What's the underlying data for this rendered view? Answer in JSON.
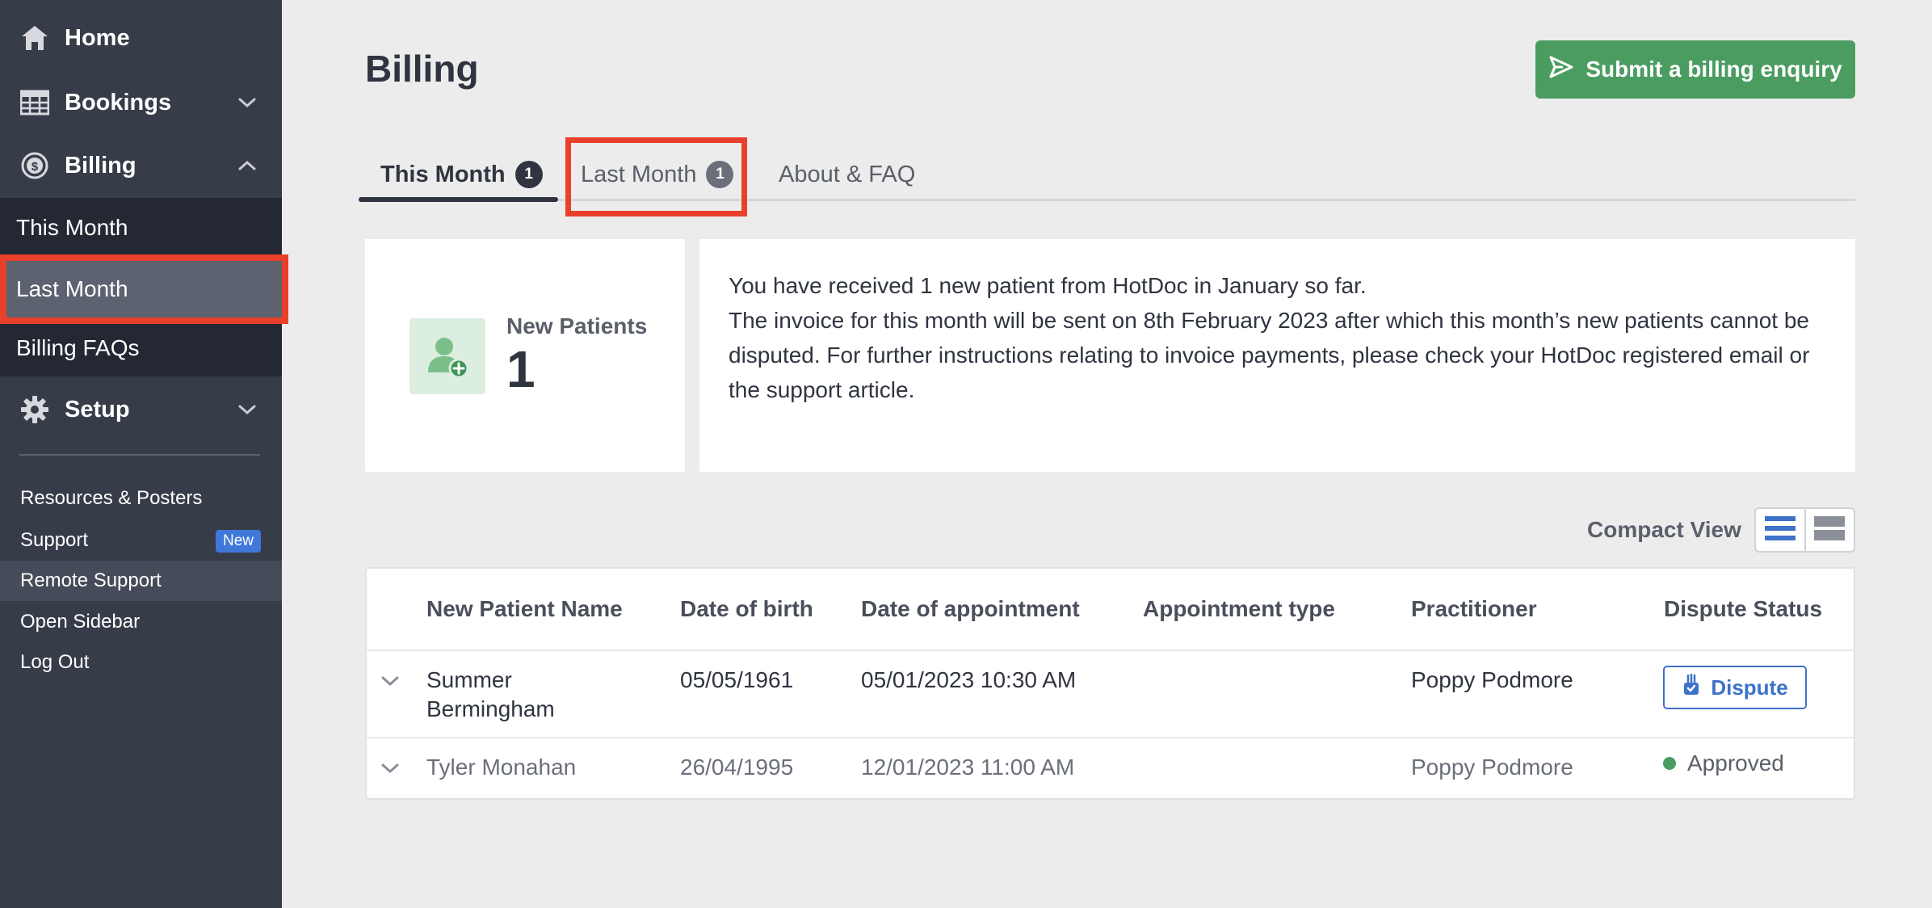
{
  "sidebar": {
    "home": "Home",
    "bookings": "Bookings",
    "billing": "Billing",
    "billing_sub": [
      "This Month",
      "Last Month",
      "Billing FAQs"
    ],
    "setup": "Setup",
    "links": [
      "Resources & Posters",
      "Support",
      "Remote Support",
      "Open Sidebar",
      "Log Out"
    ],
    "support_badge": "New"
  },
  "header": {
    "title": "Billing",
    "enquiry_button": "Submit a billing enquiry"
  },
  "tabs": [
    {
      "label": "This Month",
      "count": "1",
      "active": true
    },
    {
      "label": "Last Month",
      "count": "1",
      "active": false
    },
    {
      "label": "About & FAQ",
      "active": false
    }
  ],
  "summary": {
    "label": "New Patients",
    "value": "1",
    "info_line1": "You have received 1 new patient from HotDoc in January so far.",
    "info_line2": "The invoice for this month will be sent on 8th February 2023 after which this month’s new patients cannot be disputed. For further instructions relating to invoice payments, please check your HotDoc registered email or the support article."
  },
  "view": {
    "label": "Compact View"
  },
  "table": {
    "headers": [
      "New Patient Name",
      "Date of birth",
      "Date of appointment",
      "Appointment type",
      "Practitioner",
      "Dispute Status"
    ],
    "rows": [
      {
        "name_line1": "Summer",
        "name_line2": "Bermingham",
        "dob": "05/05/1961",
        "appointment": "05/01/2023 10:30 AM",
        "type": "",
        "practitioner": "Poppy Podmore",
        "status_action": "Dispute"
      },
      {
        "name": "Tyler Monahan",
        "dob": "26/04/1995",
        "appointment": "12/01/2023 11:00 AM",
        "type": "",
        "practitioner": "Poppy Podmore",
        "status": "Approved"
      }
    ]
  },
  "colors": {
    "sidebar_bg": "#363c48",
    "sidebar_sub_bg": "#232832",
    "highlight": "#e8402a",
    "primary_green": "#4a9c60",
    "accent_blue": "#3d72c9"
  }
}
